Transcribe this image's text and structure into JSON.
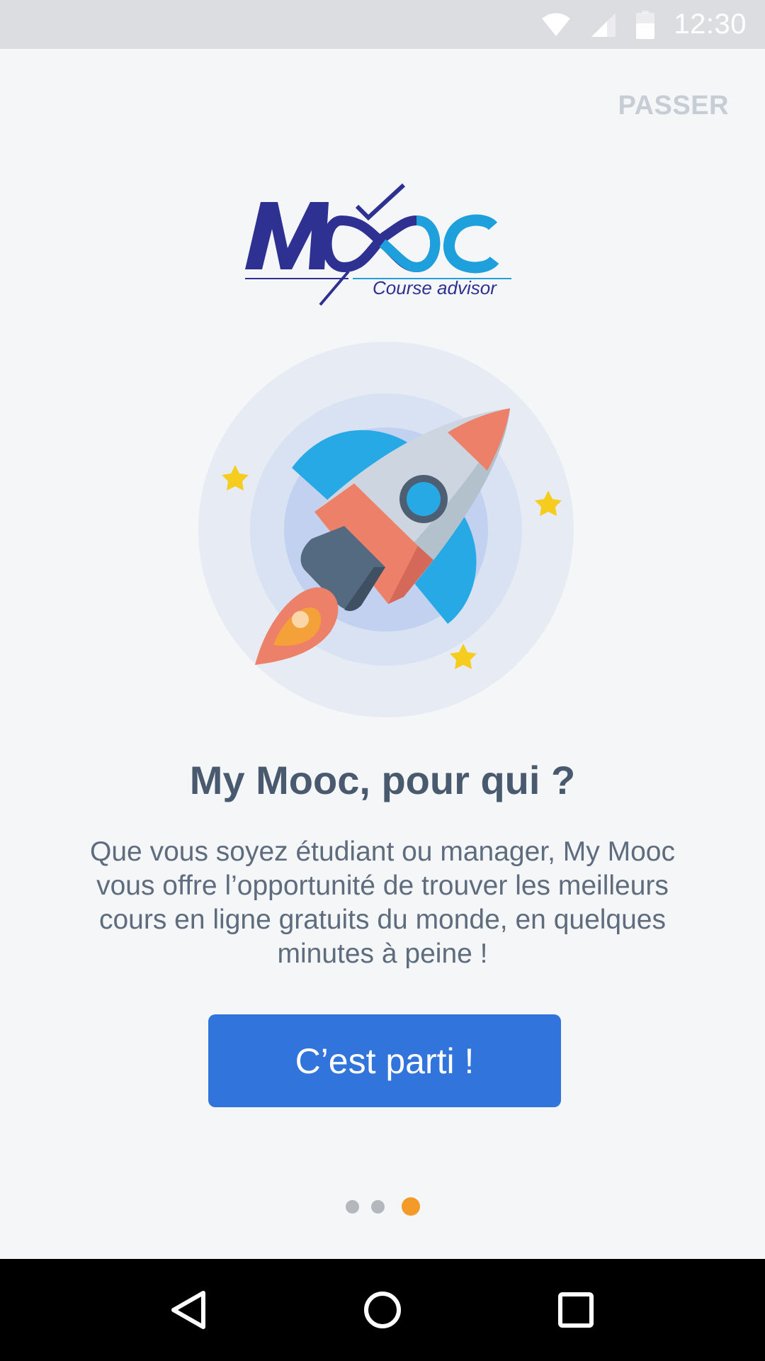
{
  "status_bar": {
    "time": "12:30",
    "icons": [
      "wifi-icon",
      "cell-signal-icon",
      "battery-icon"
    ]
  },
  "header": {
    "skip_label": "PASSER"
  },
  "logo": {
    "wordmark": "Mooc",
    "tagline": "Course advisor",
    "colors": {
      "primary": "#2e3192",
      "secondary": "#1ea0dc"
    }
  },
  "illustration": {
    "icon": "rocket-icon"
  },
  "content": {
    "title": "My Mooc, pour qui ?",
    "description": "Que vous soyez étudiant ou manager, My Mooc vous offre l’opportunité de trouver les meilleurs cours en ligne gratuits du monde, en quelques minutes à peine !"
  },
  "cta": {
    "label": "C’est parti !",
    "color": "#3174dc"
  },
  "pagination": {
    "total": 3,
    "current": 3,
    "active_color": "#f39a29"
  },
  "nav_bar": {
    "buttons": [
      "back-icon",
      "home-icon",
      "recents-icon"
    ]
  }
}
